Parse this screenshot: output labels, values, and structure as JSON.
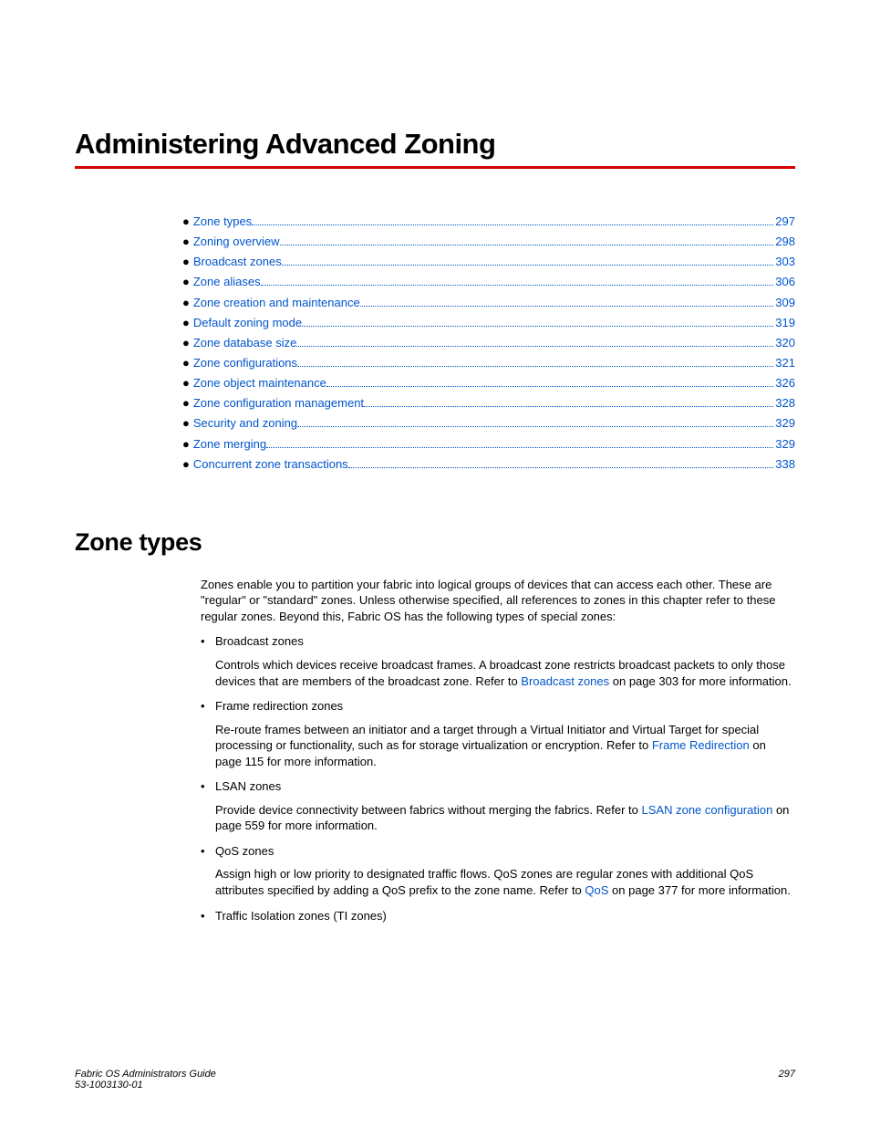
{
  "chapter_title": "Administering Advanced Zoning",
  "toc": [
    {
      "label": "Zone types",
      "page": "297"
    },
    {
      "label": "Zoning overview",
      "page": "298"
    },
    {
      "label": "Broadcast zones",
      "page": "303"
    },
    {
      "label": "Zone aliases",
      "page": "306"
    },
    {
      "label": "Zone creation and maintenance",
      "page": "309"
    },
    {
      "label": "Default zoning mode",
      "page": "319"
    },
    {
      "label": "Zone database size",
      "page": "320"
    },
    {
      "label": "Zone configurations",
      "page": "321"
    },
    {
      "label": "Zone object maintenance",
      "page": "326"
    },
    {
      "label": "Zone configuration management",
      "page": "328"
    },
    {
      "label": "Security and zoning",
      "page": "329"
    },
    {
      "label": "Zone merging",
      "page": "329"
    },
    {
      "label": "Concurrent zone transactions",
      "page": "338"
    }
  ],
  "section_title": "Zone types",
  "intro": "Zones enable you to partition your fabric into logical groups of devices that can access each other. These are \"regular\" or \"standard\" zones. Unless otherwise specified, all references to zones in this chapter refer to these regular zones. Beyond this, Fabric OS has the following types of special zones:",
  "bullets": {
    "broadcast": {
      "head": "Broadcast zones",
      "pre": "Controls which devices receive broadcast frames. A broadcast zone restricts broadcast packets to only those devices that are members of the broadcast zone. Refer to ",
      "link": "Broadcast zones",
      "post": " on page 303 for more information."
    },
    "frame": {
      "head": "Frame redirection zones",
      "pre": "Re-route frames between an initiator and a target through a Virtual Initiator and Virtual Target for special processing or functionality, such as for storage virtualization or encryption. Refer to ",
      "link": "Frame Redirection",
      "post": " on page 115 for more information."
    },
    "lsan": {
      "head": "LSAN zones",
      "pre": "Provide device connectivity between fabrics without merging the fabrics. Refer to ",
      "link": "LSAN zone configuration",
      "post": " on page 559 for more information."
    },
    "qos": {
      "head": "QoS zones",
      "pre": "Assign high or low priority to designated traffic flows. QoS zones are regular zones with additional QoS attributes specified by adding a QoS prefix to the zone name. Refer to ",
      "link": "QoS",
      "post": " on page 377 for more information."
    },
    "ti": {
      "head": "Traffic Isolation zones (TI zones)"
    }
  },
  "footer": {
    "doc_title": "Fabric OS Administrators Guide",
    "doc_num": "53-1003130-01",
    "page_num": "297"
  }
}
